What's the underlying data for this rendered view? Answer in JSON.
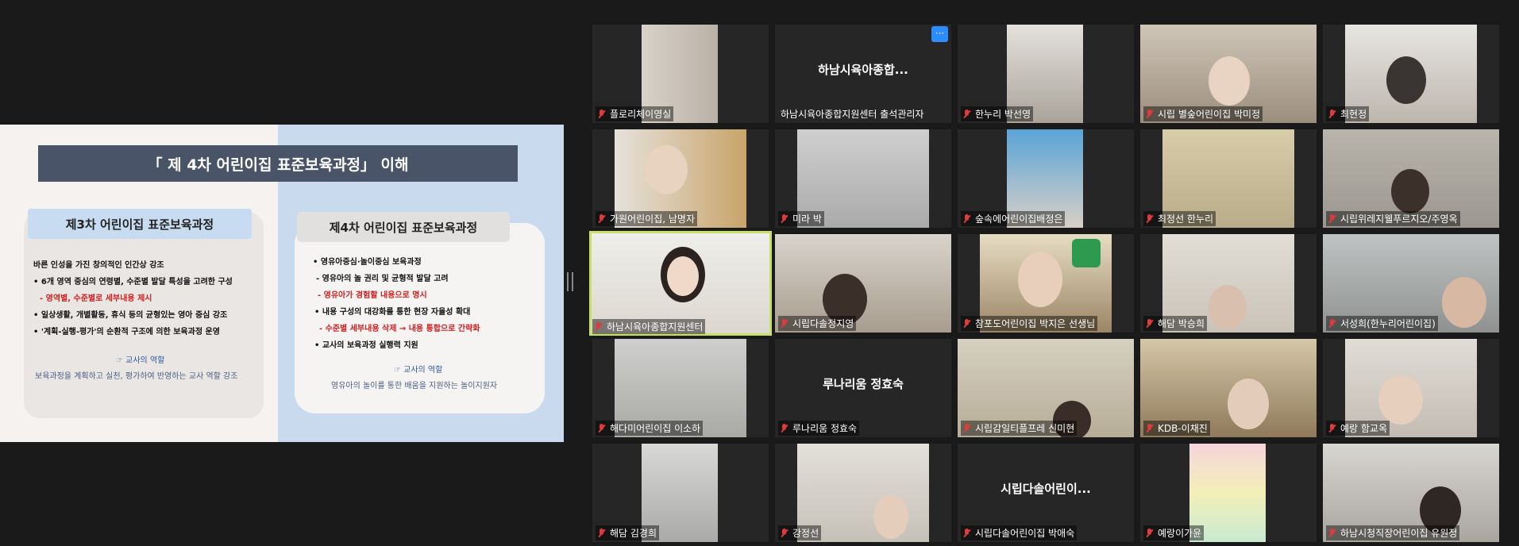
{
  "slide": {
    "title": "「 제 4차 어린이집 표준보육과정」 이해",
    "left": {
      "header": "제3차 어린이집 표준보육과정",
      "lines": [
        "바른 인성을 가진 창의적인 인간상 강조",
        "• 6개 영역 중심의 연령별, 수준별 발달 특성을 고려한 구성",
        "- 영역별, 수준별로 세부내용 제시",
        "• 일상생활, 개별활동, 휴식 등의 균형있는 영아 중심 강조",
        "• '계획-실행-평가'의 순환적 구조에 의한 보육과정 운영"
      ],
      "role_title": "☞ 교사의 역할",
      "role_text": "보육과정을 계획하고 실천, 평가하여 반영하는 교사 역할 강조"
    },
    "right": {
      "header": "제4차 어린이집 표준보육과정",
      "lines": [
        "• 영유아중심·놀이중심 보육과정",
        "- 영유아의 놀 권리 및 균형적 발달 고려",
        "- 영유아가 경험할 내용으로 명시",
        "• 내용 구성의 대강화를 통한 현장 자율성 확대",
        "- 수준별 세부내용 삭제 → 내용 통합으로 간략화",
        "• 교사의 보육과정 실행력 지원"
      ],
      "role_title": "☞ 교사의 역할",
      "role_text": "영유아의 놀이를 통한 배움을 지원하는 놀이지원자"
    }
  },
  "more_button": "···",
  "participants": [
    {
      "name": "플로리체이영실",
      "big": ""
    },
    {
      "name": "하남시육아종합지원센터 출석관리자",
      "big": "하남시육아종합..."
    },
    {
      "name": "한누리 박선영",
      "big": ""
    },
    {
      "name": "시립 별숲어린이집 박미정",
      "big": ""
    },
    {
      "name": "최현정",
      "big": ""
    },
    {
      "name": "가원어린이집, 남명자",
      "big": ""
    },
    {
      "name": "미라 박",
      "big": ""
    },
    {
      "name": "숲속에어린이집배정은",
      "big": ""
    },
    {
      "name": "최정선 한누리",
      "big": ""
    },
    {
      "name": "시립위레지웰푸르지오/주영옥",
      "big": ""
    },
    {
      "name": "하남시육아종합지원센터",
      "big": ""
    },
    {
      "name": "시립다솔정지영",
      "big": ""
    },
    {
      "name": "참포도어린이집 박지은 선생님",
      "big": ""
    },
    {
      "name": "해담 박승희",
      "big": ""
    },
    {
      "name": "서성희(한누리어린이집)",
      "big": ""
    },
    {
      "name": "해다미어린이집 이소하",
      "big": ""
    },
    {
      "name": "루나리움 정효숙",
      "big": "루나리움 정효숙"
    },
    {
      "name": "시립감일티플프레 신미현",
      "big": ""
    },
    {
      "name": "KDB-이채진",
      "big": ""
    },
    {
      "name": "예랑 함교옥",
      "big": ""
    },
    {
      "name": "해담 김경희",
      "big": ""
    },
    {
      "name": "강정선",
      "big": ""
    },
    {
      "name": "시립다솔어린이집 박애숙",
      "big": "시립다솔어린이..."
    },
    {
      "name": "예랑이가윤",
      "big": ""
    },
    {
      "name": "하남시청직장어린이집 유원정",
      "big": ""
    }
  ]
}
